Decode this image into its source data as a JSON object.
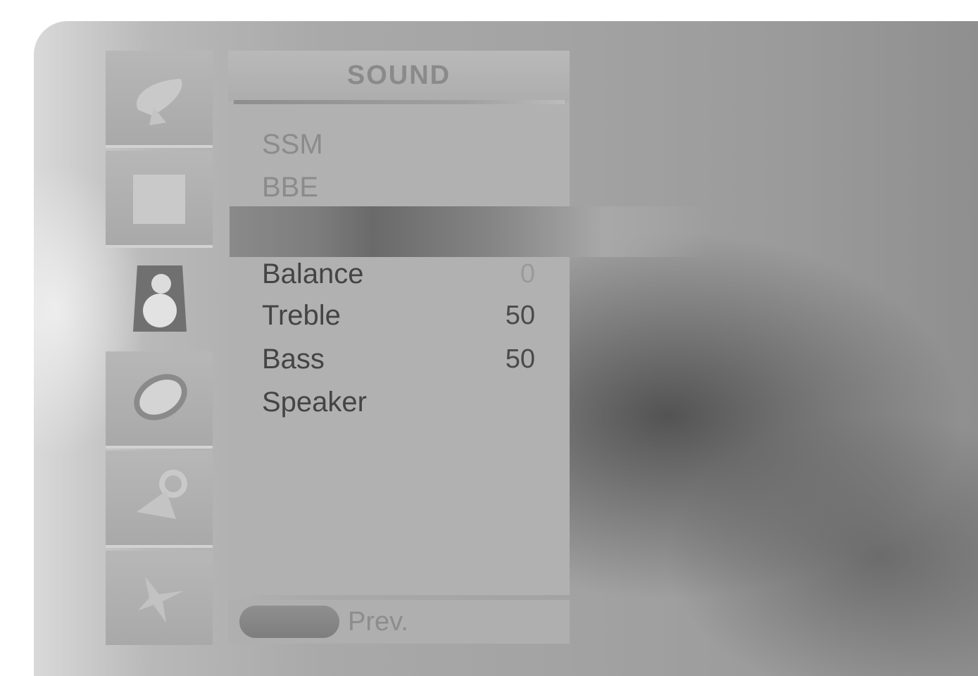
{
  "menu": {
    "title": "SOUND",
    "items": [
      {
        "label": "SSM",
        "value": "",
        "enabled": false
      },
      {
        "label": "BBE",
        "value": "",
        "enabled": false
      },
      {
        "label": "",
        "value": "",
        "enabled": true,
        "selected": true
      },
      {
        "label": "Balance",
        "value": "0",
        "enabled": true
      },
      {
        "label": "Treble",
        "value": "50",
        "enabled": true
      },
      {
        "label": "Bass",
        "value": "50",
        "enabled": true
      },
      {
        "label": "Speaker",
        "value": "",
        "enabled": true
      }
    ]
  },
  "sidebar": {
    "icons": [
      "satellite-dish-icon",
      "picture-icon",
      "speaker-icon",
      "clock-icon",
      "padlock-icon",
      "airplane-icon"
    ],
    "selected_index": 2
  },
  "footer": {
    "button_label": "Prev."
  }
}
